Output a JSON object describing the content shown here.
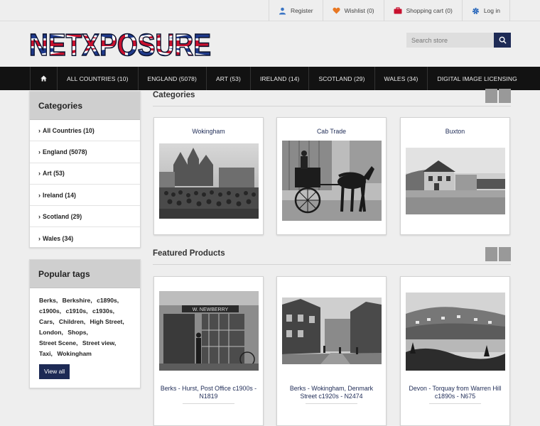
{
  "header_links": [
    {
      "label": "Register",
      "icon": "user-icon"
    },
    {
      "label": "Wishlist (0)",
      "icon": "heart-icon"
    },
    {
      "label": "Shopping cart (0)",
      "icon": "cart-icon"
    },
    {
      "label": "Log in",
      "icon": "gear-icon"
    }
  ],
  "logo": {
    "text": "NETXPOSURE"
  },
  "search": {
    "placeholder": "Search store"
  },
  "nav": {
    "home_icon": "home-icon",
    "items": [
      "ALL COUNTRIES (10)",
      "ENGLAND (5078)",
      "ART (53)",
      "IRELAND (14)",
      "SCOTLAND (29)",
      "WALES (34)",
      "DIGITAL IMAGE LICENSING"
    ]
  },
  "sidebar": {
    "categories_title": "Categories",
    "categories": [
      "All Countries (10)",
      "England (5078)",
      "Art (53)",
      "Ireland (14)",
      "Scotland (29)",
      "Wales (34)"
    ],
    "tags_title": "Popular tags",
    "tags": [
      "Berks,",
      "Berkshire,",
      "c1890s,",
      "c1900s,",
      "c1910s,",
      "c1930s,",
      "Cars,",
      "Children,",
      "High Street,",
      "London,",
      "Shops,",
      "Street Scene,",
      "Street view,",
      "Taxi,",
      "Wokingham"
    ],
    "view_all_label": "View all"
  },
  "main": {
    "categories_title": "Categories",
    "category_cards": [
      "Wokingham",
      "Cab Trade",
      "Buxton"
    ],
    "featured_title": "Featured Products",
    "products": [
      {
        "title": "Berks - Hurst, Post Office c1900s - N1819",
        "sign": "W. NEWBERRY"
      },
      {
        "title": "Berks - Wokingham, Denmark Street c1920s - N2474"
      },
      {
        "title": "Devon - Torquay from Warren Hill c1890s - N675"
      }
    ]
  },
  "colors": {
    "brand_navy": "#1d2a55",
    "nav_bg": "#121212",
    "logo_red": "#c8102e"
  }
}
